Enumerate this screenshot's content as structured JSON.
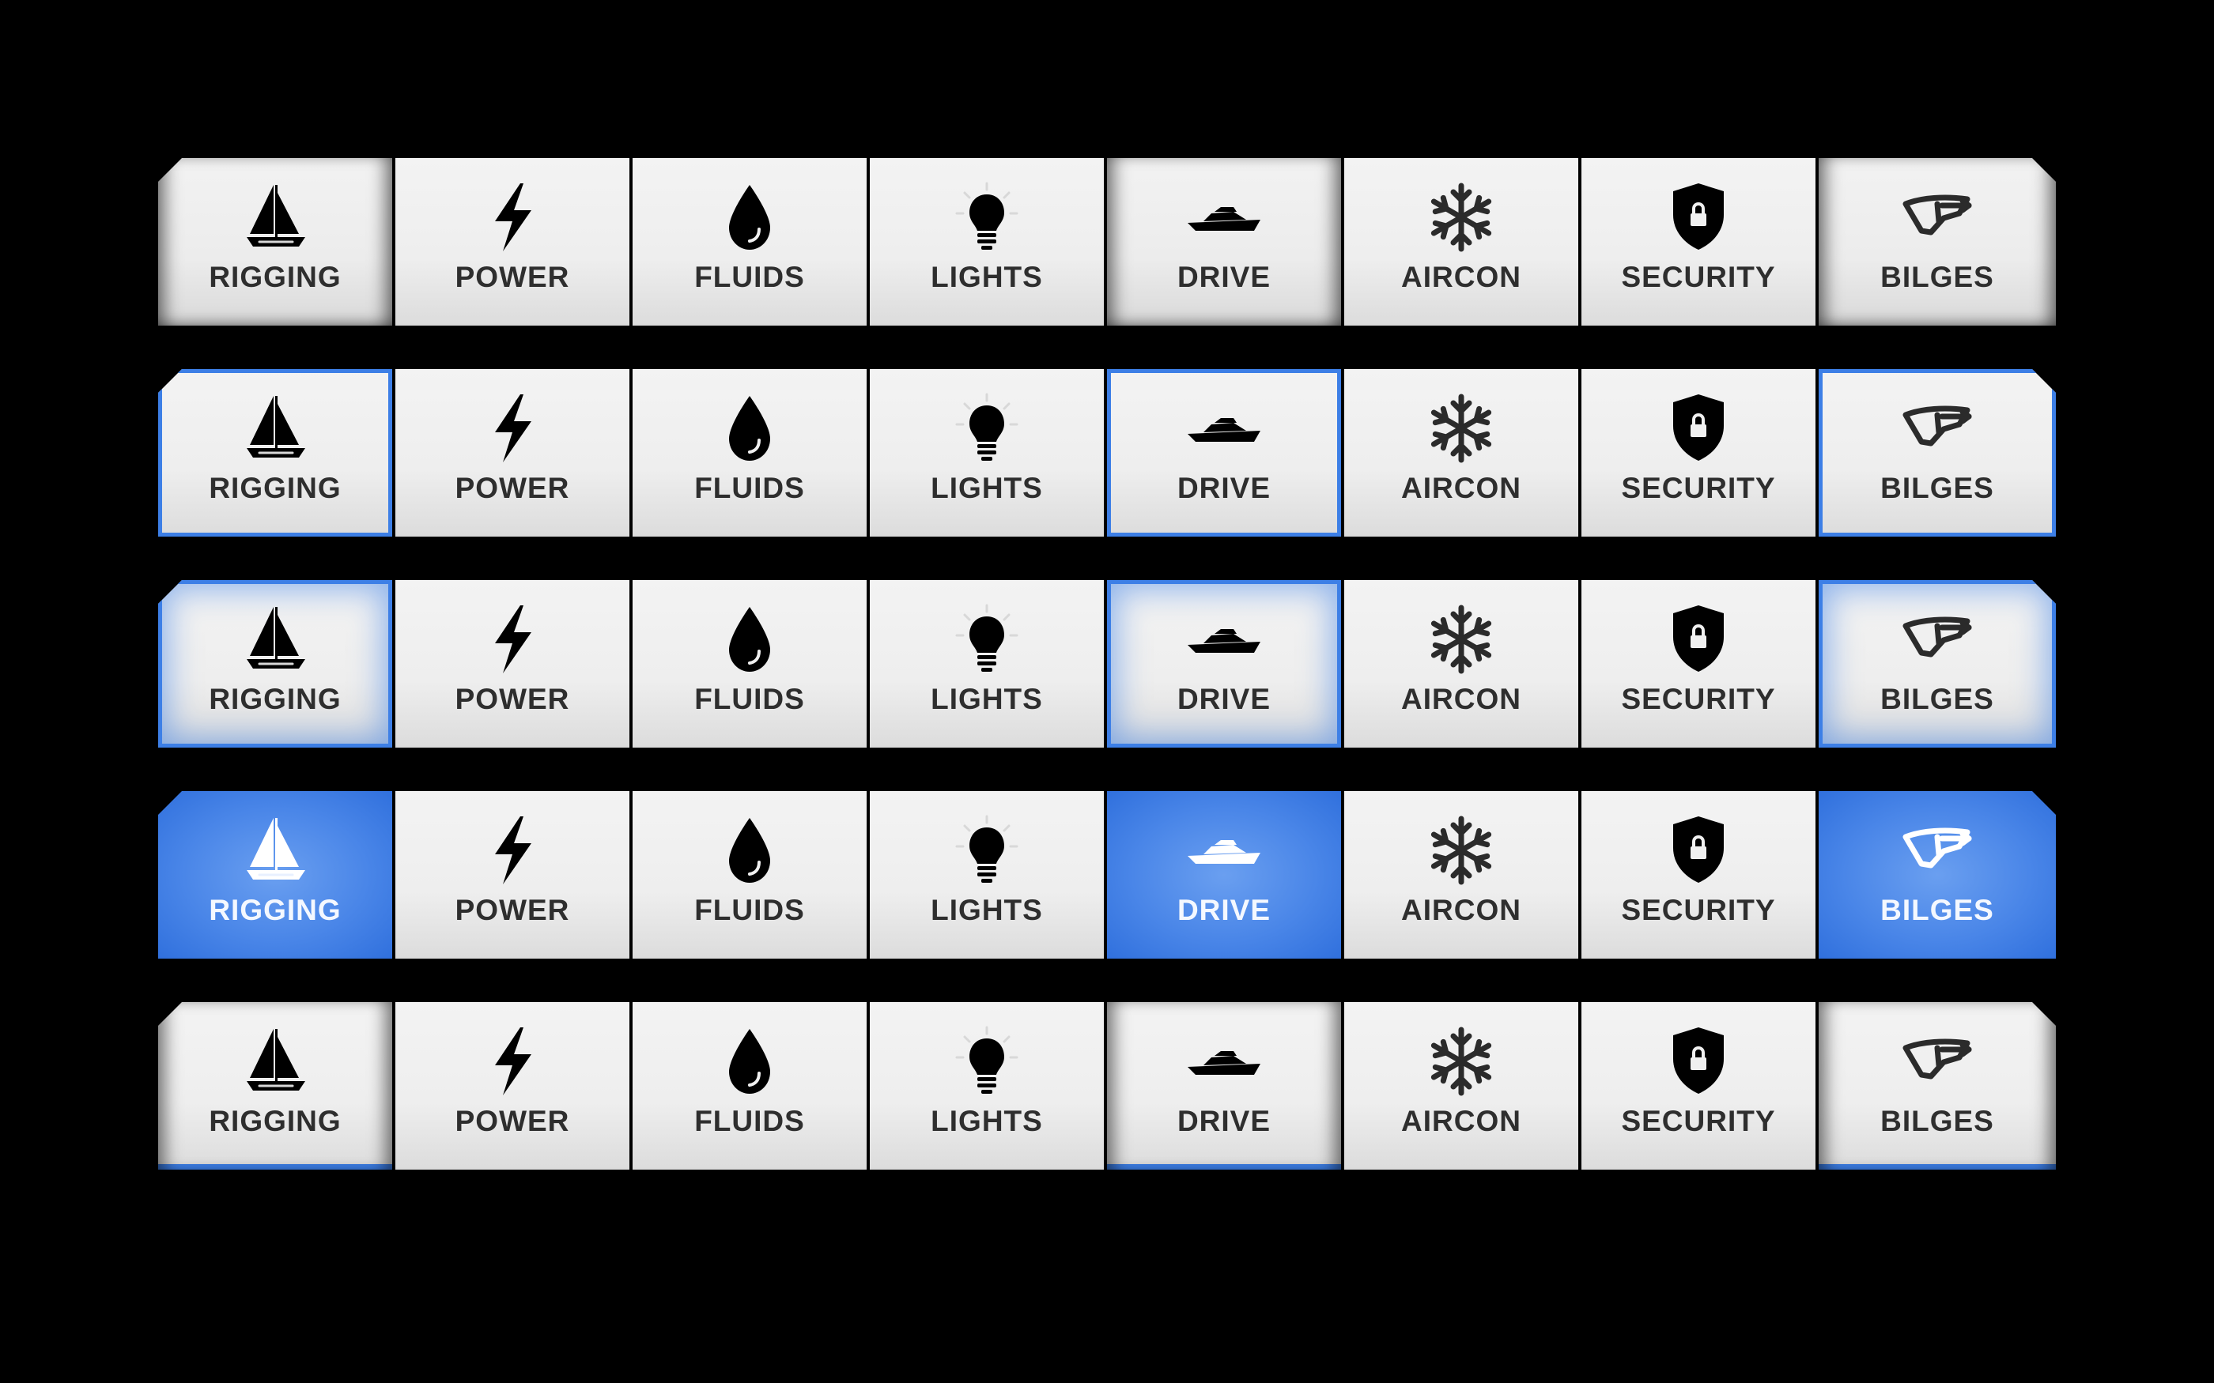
{
  "rows": [
    {
      "style": "shadow",
      "items": [
        {
          "label": "RIGGING",
          "icon": "sailboat-icon",
          "selected": true
        },
        {
          "label": "POWER",
          "icon": "lightning-icon",
          "selected": false
        },
        {
          "label": "FLUIDS",
          "icon": "droplet-icon",
          "selected": false
        },
        {
          "label": "LIGHTS",
          "icon": "lightbulb-icon",
          "selected": false
        },
        {
          "label": "DRIVE",
          "icon": "motor-yacht-icon",
          "selected": true
        },
        {
          "label": "AIRCON",
          "icon": "snowflake-icon",
          "selected": false
        },
        {
          "label": "SECURITY",
          "icon": "shield-lock-icon",
          "selected": false
        },
        {
          "label": "BILGES",
          "icon": "bilge-pump-icon",
          "selected": true
        }
      ]
    },
    {
      "style": "outline",
      "items": [
        {
          "label": "RIGGING",
          "icon": "sailboat-icon",
          "selected": true
        },
        {
          "label": "POWER",
          "icon": "lightning-icon",
          "selected": false
        },
        {
          "label": "FLUIDS",
          "icon": "droplet-icon",
          "selected": false
        },
        {
          "label": "LIGHTS",
          "icon": "lightbulb-icon",
          "selected": false
        },
        {
          "label": "DRIVE",
          "icon": "motor-yacht-icon",
          "selected": true
        },
        {
          "label": "AIRCON",
          "icon": "snowflake-icon",
          "selected": false
        },
        {
          "label": "SECURITY",
          "icon": "shield-lock-icon",
          "selected": false
        },
        {
          "label": "BILGES",
          "icon": "bilge-pump-icon",
          "selected": true
        }
      ]
    },
    {
      "style": "glow",
      "items": [
        {
          "label": "RIGGING",
          "icon": "sailboat-icon",
          "selected": true
        },
        {
          "label": "POWER",
          "icon": "lightning-icon",
          "selected": false
        },
        {
          "label": "FLUIDS",
          "icon": "droplet-icon",
          "selected": false
        },
        {
          "label": "LIGHTS",
          "icon": "lightbulb-icon",
          "selected": false
        },
        {
          "label": "DRIVE",
          "icon": "motor-yacht-icon",
          "selected": true
        },
        {
          "label": "AIRCON",
          "icon": "snowflake-icon",
          "selected": false
        },
        {
          "label": "SECURITY",
          "icon": "shield-lock-icon",
          "selected": false
        },
        {
          "label": "BILGES",
          "icon": "bilge-pump-icon",
          "selected": true
        }
      ]
    },
    {
      "style": "fill",
      "items": [
        {
          "label": "RIGGING",
          "icon": "sailboat-icon",
          "selected": true
        },
        {
          "label": "POWER",
          "icon": "lightning-icon",
          "selected": false
        },
        {
          "label": "FLUIDS",
          "icon": "droplet-icon",
          "selected": false
        },
        {
          "label": "LIGHTS",
          "icon": "lightbulb-icon",
          "selected": false
        },
        {
          "label": "DRIVE",
          "icon": "motor-yacht-icon",
          "selected": true
        },
        {
          "label": "AIRCON",
          "icon": "snowflake-icon",
          "selected": false
        },
        {
          "label": "SECURITY",
          "icon": "shield-lock-icon",
          "selected": false
        },
        {
          "label": "BILGES",
          "icon": "bilge-pump-icon",
          "selected": true
        }
      ]
    },
    {
      "style": "underline",
      "items": [
        {
          "label": "RIGGING",
          "icon": "sailboat-icon",
          "selected": true
        },
        {
          "label": "POWER",
          "icon": "lightning-icon",
          "selected": false
        },
        {
          "label": "FLUIDS",
          "icon": "droplet-icon",
          "selected": false
        },
        {
          "label": "LIGHTS",
          "icon": "lightbulb-icon",
          "selected": false
        },
        {
          "label": "DRIVE",
          "icon": "motor-yacht-icon",
          "selected": true
        },
        {
          "label": "AIRCON",
          "icon": "snowflake-icon",
          "selected": false
        },
        {
          "label": "SECURITY",
          "icon": "shield-lock-icon",
          "selected": false
        },
        {
          "label": "BILGES",
          "icon": "bilge-pump-icon",
          "selected": true
        }
      ]
    }
  ],
  "colors": {
    "background": "#000000",
    "button_face": "#eeeeee",
    "accent_blue": "#3d7fe6",
    "icon_dark": "#2b2b2b",
    "label_dark": "#2e2e2e"
  }
}
